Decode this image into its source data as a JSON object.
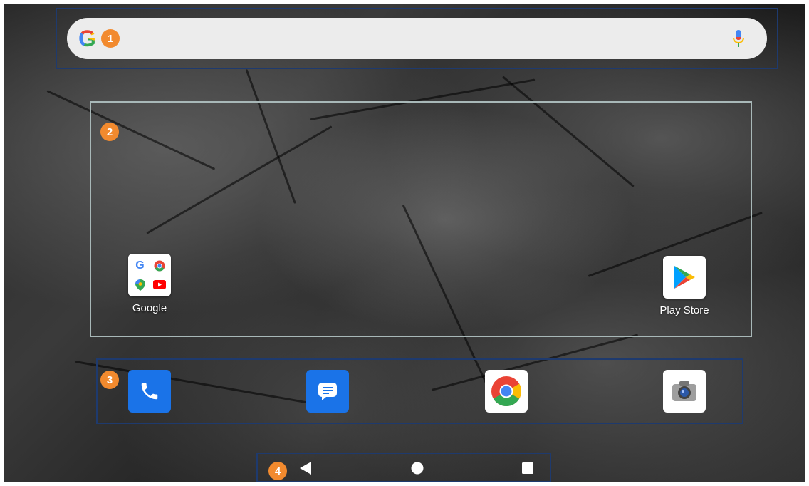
{
  "search_bar": {
    "logo": "G",
    "mic_icon": "mic-icon"
  },
  "annotations": {
    "badge_1": "1",
    "badge_2": "2",
    "badge_3": "3",
    "badge_4": "4"
  },
  "home_apps": [
    {
      "label": "Google",
      "icon": "google-folder-icon"
    },
    {
      "label": "Play Store",
      "icon": "play-store-icon"
    }
  ],
  "dock_apps": [
    {
      "name": "Phone",
      "icon": "phone-icon"
    },
    {
      "name": "Messages",
      "icon": "messages-icon"
    },
    {
      "name": "Chrome",
      "icon": "chrome-icon"
    },
    {
      "name": "Camera",
      "icon": "camera-icon"
    }
  ],
  "nav_bar": {
    "back": "back-icon",
    "home": "home-icon",
    "recents": "recents-icon"
  },
  "colors": {
    "badge": "#f28a2e",
    "annotation_border": "#1e3a6e",
    "annotation_border_light": "#a8b8b8",
    "search_bg": "#ececec",
    "phone_blue": "#1a73e8"
  }
}
